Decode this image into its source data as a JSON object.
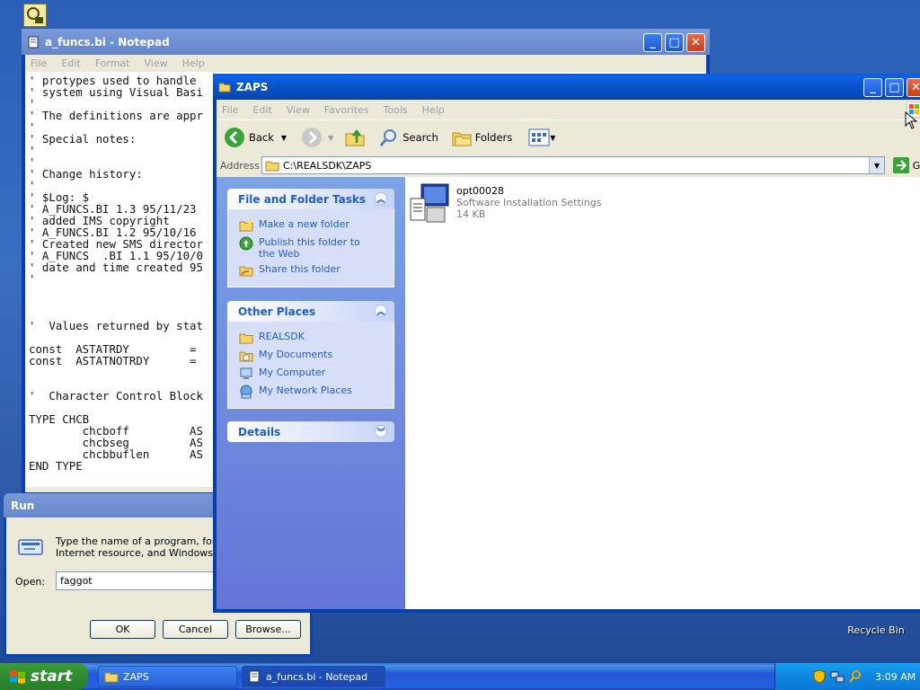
{
  "notepad": {
    "title": "a_funcs.bi - Notepad",
    "menu": [
      "File",
      "Edit",
      "Format",
      "View",
      "Help"
    ],
    "lines": [
      "' protypes used to handle",
      "' system using Visual Basi",
      "'",
      "' The definitions are appr",
      "'",
      "' Special notes:",
      "'",
      "'",
      "' Change history:",
      "'",
      "' $Log: $",
      "' A_FUNCS.BI 1.3 95/11/23",
      "' added IMS copyright",
      "' A_FUNCS.BI 1.2 95/10/16",
      "' Created new SMS director",
      "' A_FUNCS  .BI 1.1 95/10/0",
      "' date and time created 95",
      "'",
      "",
      "",
      "",
      "'  Values returned by stat",
      "",
      "const  ASTATRDY         =",
      "const  ASTATNOTRDY      =",
      "",
      "",
      "'  Character Control Block",
      "",
      "TYPE CHCB",
      "        chcboff         AS",
      "        chcbseg         AS",
      "        chcbbuflen      AS",
      "END TYPE"
    ]
  },
  "run": {
    "title": "Run",
    "description_line1": "Type the name of a program, folder,",
    "description_line2": "Internet resource, and Windows will",
    "open_label": "Open:",
    "open_value": "faggot",
    "ok": "OK",
    "cancel": "Cancel",
    "browse": "Browse..."
  },
  "explorer": {
    "title": "ZAPS",
    "menu": [
      "File",
      "Edit",
      "View",
      "Favorites",
      "Tools",
      "Help"
    ],
    "toolbar": {
      "back": "Back",
      "search": "Search",
      "folders": "Folders"
    },
    "address_label": "Address",
    "address_value": "C:\\REALSDK\\ZAPS",
    "go": "Go",
    "tasks_header": "File and Folder Tasks",
    "tasks": [
      "Make a new folder",
      "Publish this folder to the Web",
      "Share this folder"
    ],
    "places_header": "Other Places",
    "places": [
      "REALSDK",
      "My Documents",
      "My Computer",
      "My Network Places"
    ],
    "details_header": "Details",
    "file": {
      "name": "opt00028",
      "type": "Software Installation Settings",
      "size": "14 KB"
    }
  },
  "desktop": {
    "recycle_bin": "Recycle Bin"
  },
  "taskbar": {
    "start": "start",
    "tasks": [
      "ZAPS",
      "a_funcs.bi - Notepad"
    ],
    "clock": "3:09 AM"
  },
  "colors": {
    "title_active": "#0653c9",
    "link_blue": "#215dc6",
    "start_green": "#308f30"
  }
}
